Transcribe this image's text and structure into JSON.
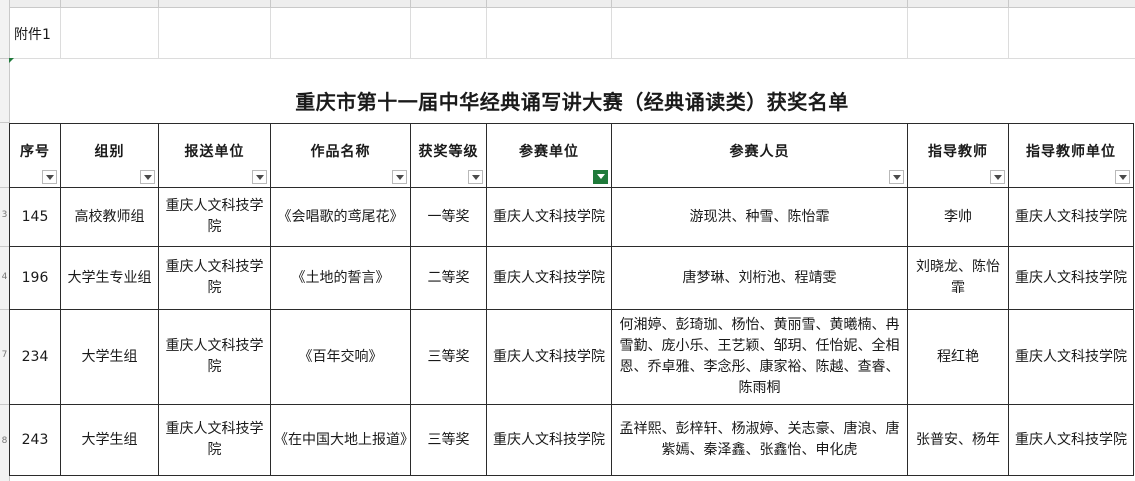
{
  "sheet": {
    "attachment_label": "附件1",
    "title": "重庆市第十一届中华经典诵写讲大赛（经典诵读类）获奖名单"
  },
  "table": {
    "headers": [
      "序号",
      "组别",
      "报送单位",
      "作品名称",
      "获奖等级",
      "参赛单位",
      "参赛人员",
      "指导教师",
      "指导教师单位"
    ],
    "active_filter_column": "参赛单位",
    "rows": [
      {
        "seq": "145",
        "group": "高校教师组",
        "submit_unit": "重庆人文科技学院",
        "work": "《会唱歌的鸢尾花》",
        "award": "一等奖",
        "participant_unit": "重庆人文科技学院",
        "participants": "游现洪、种雪、陈怡霏",
        "teacher": "李帅",
        "teacher_unit": "重庆人文科技学院"
      },
      {
        "seq": "196",
        "group": "大学生专业组",
        "submit_unit": "重庆人文科技学院",
        "work": "《土地的誓言》",
        "award": "二等奖",
        "participant_unit": "重庆人文科技学院",
        "participants": "唐梦琳、刘桁池、程靖雯",
        "teacher": "刘晓龙、陈怡霏",
        "teacher_unit": "重庆人文科技学院"
      },
      {
        "seq": "234",
        "group": "大学生组",
        "submit_unit": "重庆人文科技学院",
        "work": "《百年交响》",
        "award": "三等奖",
        "participant_unit": "重庆人文科技学院",
        "participants": "何湘婷、彭琦珈、杨怡、黄丽雪、黄曦楠、冉雪勤、庞小乐、王艺颖、邹玥、任怡妮、全相恩、乔卓雅、李念彤、康家裕、陈越、查睿、陈雨桐",
        "teacher": "程红艳",
        "teacher_unit": "重庆人文科技学院"
      },
      {
        "seq": "243",
        "group": "大学生组",
        "submit_unit": "重庆人文科技学院",
        "work": "《在中国大地上报道》",
        "award": "三等奖",
        "participant_unit": "重庆人文科技学院",
        "participants": "孟祥熙、彭梓轩、杨淑婷、关志豪、唐浪、唐紫嫣、秦泽鑫、张鑫怡、申化虎",
        "teacher": "张普安、杨年",
        "teacher_unit": "重庆人文科技学院"
      }
    ]
  },
  "row_numbers": [
    "3",
    "4",
    "7",
    "8"
  ],
  "colors": {
    "filter_active": "#1f7a3a",
    "grid": "#dcdcdc",
    "border": "#2b2b2b"
  }
}
